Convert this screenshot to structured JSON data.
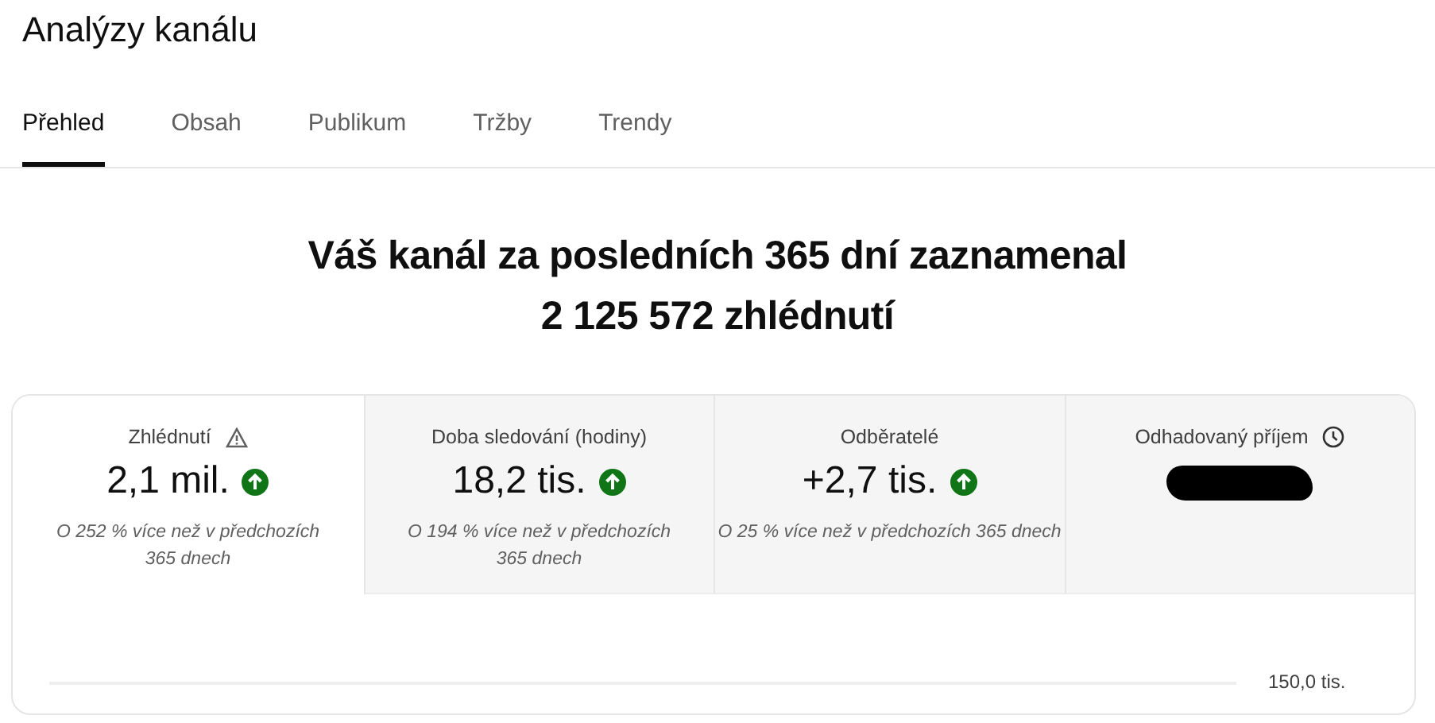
{
  "page": {
    "title": "Analýzy kanálu"
  },
  "tabs": [
    {
      "label": "Přehled",
      "selected": true
    },
    {
      "label": "Obsah",
      "selected": false
    },
    {
      "label": "Publikum",
      "selected": false
    },
    {
      "label": "Tržby",
      "selected": false
    },
    {
      "label": "Trendy",
      "selected": false
    }
  ],
  "headline": [
    "Váš kanál za posledních 365 dní zaznamenal",
    "2 125 572 zhlédnutí"
  ],
  "metrics": [
    {
      "kind": "flagged",
      "label": "Zhlédnutí",
      "value": "2,1 mil.",
      "increase": true,
      "note": "O 252 % více než v předchozích 365 dnech",
      "selected": true
    },
    {
      "kind": "plain",
      "label": "Doba sledování (hodiny)",
      "value": "18,2 tis.",
      "increase": true,
      "note": "O 194 % více než v předchozích 365 dnech",
      "selected": false
    },
    {
      "kind": "plain",
      "label": "Odběratelé",
      "value": "+2,7 tis.",
      "increase": true,
      "note": "O 25 % více než v předchozích 365 dnech",
      "selected": false
    },
    {
      "kind": "estimated",
      "label": "Odhadovaný příjem",
      "redacted": true,
      "selected": false
    }
  ],
  "chart": {
    "gridline_label": "150,0 tis."
  }
}
